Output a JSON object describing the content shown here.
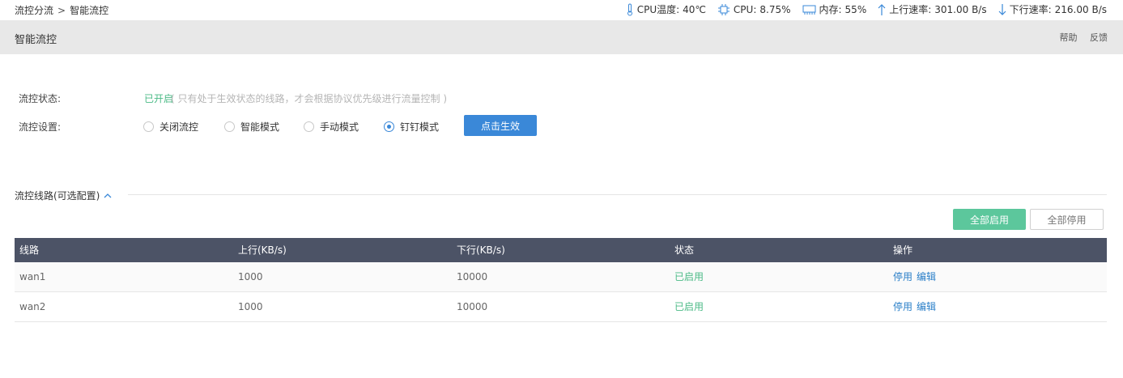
{
  "breadcrumb": {
    "parent": "流控分流",
    "separator": ">",
    "current": "智能流控"
  },
  "stats": {
    "cpu_temp_label": "CPU温度:",
    "cpu_temp": "40℃",
    "cpu_label": "CPU:",
    "cpu": "8.75%",
    "mem_label": "内存:",
    "mem": "55%",
    "up_label": "上行速率:",
    "up": "301.00 B/s",
    "down_label": "下行速率:",
    "down": "216.00 B/s"
  },
  "header": {
    "title": "智能流控",
    "help": "帮助",
    "feedback": "反馈"
  },
  "form": {
    "status_label": "流控状态:",
    "status_value": "已开启",
    "status_hint": "( 只有处于生效状态的线路，才会根据协议优先级进行流量控制 )",
    "mode_label": "流控设置:",
    "modes": [
      "关闭流控",
      "智能模式",
      "手动模式",
      "钉钉模式"
    ],
    "selected_mode": "钉钉模式",
    "apply_label": "点击生效"
  },
  "section": {
    "title": "流控线路(可选配置)"
  },
  "actions": {
    "enable_all": "全部启用",
    "disable_all": "全部停用"
  },
  "table": {
    "headers": [
      "线路",
      "上行(KB/s)",
      "下行(KB/s)",
      "状态",
      "操作"
    ],
    "rows": [
      {
        "line": "wan1",
        "up": "1000",
        "down": "10000",
        "status": "已启用",
        "op1": "停用",
        "op2": "编辑"
      },
      {
        "line": "wan2",
        "up": "1000",
        "down": "10000",
        "status": "已启用",
        "op1": "停用",
        "op2": "编辑"
      }
    ]
  },
  "colors": {
    "accent": "#3a88d8",
    "success": "#4cbb87",
    "enable_btn": "#5cc79c",
    "table_header": "#4c5366",
    "link": "#2a7fc8"
  }
}
